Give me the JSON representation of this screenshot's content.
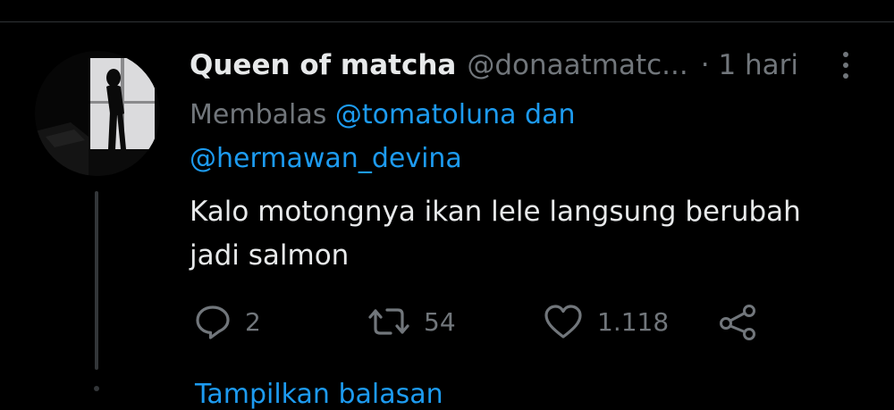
{
  "tweet": {
    "display_name": "Queen of matcha",
    "handle": "@donaatmatc...",
    "time": "· 1 hari",
    "reply_prefix": "Membalas",
    "mention_1": "@tomatoluna",
    "reply_and": "dan",
    "mention_2": "@hermawan_devina",
    "text_line1": "Kalo motongnya ikan lele langsung berubah",
    "text_line2": "jadi salmon"
  },
  "actions": {
    "reply_count": "2",
    "retweet_count": "54",
    "like_count": "1.118"
  },
  "footer": {
    "show_replies": "Tampilkan balasan"
  },
  "icons": {
    "reply": "reply-icon",
    "retweet": "retweet-icon",
    "like": "heart-icon",
    "share": "share-icon",
    "more": "more-vertical-icon"
  },
  "colors": {
    "background": "#000000",
    "text": "#e7e9ea",
    "muted": "#71767b",
    "accent": "#1d9bf0"
  }
}
